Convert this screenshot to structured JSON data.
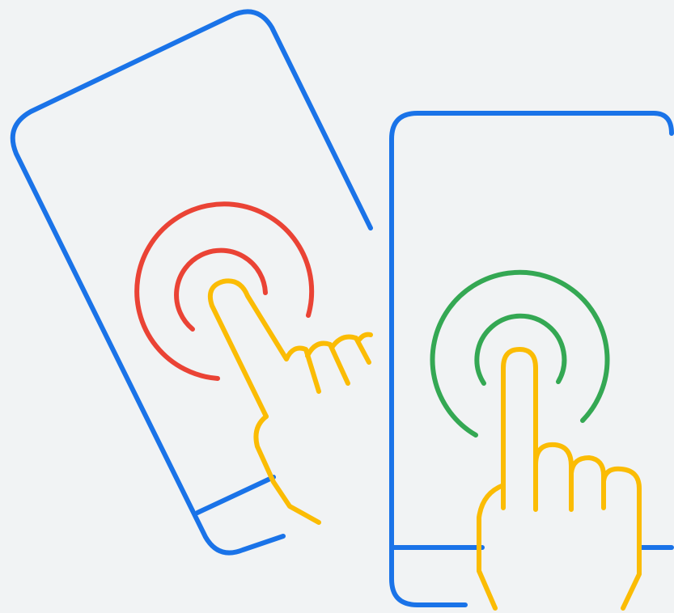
{
  "illustration": {
    "left_phone": {
      "icon": "phone-outline-icon",
      "tap_icon": "tap-ripple-icon",
      "hand_icon": "pointing-hand-icon"
    },
    "right_phone": {
      "icon": "phone-outline-icon",
      "tap_icon": "tap-ripple-icon",
      "hand_icon": "pointing-hand-icon"
    }
  },
  "colors": {
    "background": "#f1f3f4",
    "phone_outline": "#1a73e8",
    "ripple_left": "#ea4335",
    "ripple_right": "#34a853",
    "hand": "#fbbc04"
  }
}
